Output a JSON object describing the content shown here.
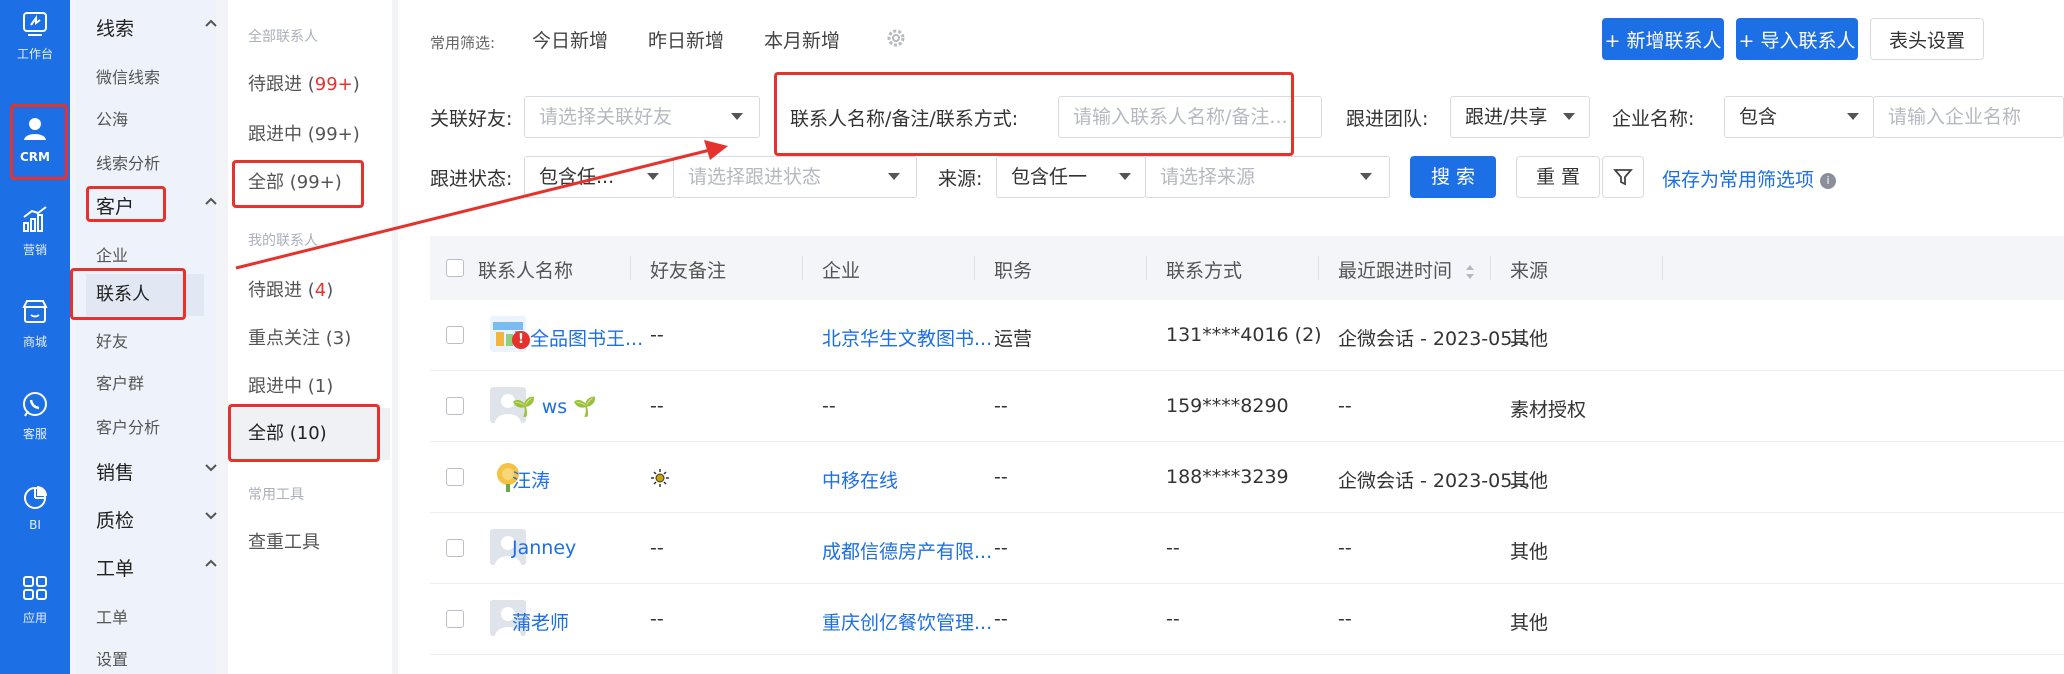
{
  "rail": {
    "items": [
      {
        "label": "工作台",
        "icon": "dashboard-icon"
      },
      {
        "label": "CRM",
        "icon": "user-icon"
      },
      {
        "label": "营销",
        "icon": "chart-icon"
      },
      {
        "label": "商城",
        "icon": "store-icon"
      },
      {
        "label": "客服",
        "icon": "whatsapp-icon"
      },
      {
        "label": "BI",
        "icon": "pie-icon"
      },
      {
        "label": "应用",
        "icon": "apps-icon"
      }
    ]
  },
  "menu": {
    "groups": [
      {
        "label": "线索"
      },
      {
        "label": "客户"
      },
      {
        "label": "销售"
      },
      {
        "label": "质检"
      },
      {
        "label": "工单"
      }
    ],
    "subs": {
      "leads": [
        "微信线索",
        "公海",
        "线索分析"
      ],
      "customer": [
        "企业",
        "联系人",
        "好友",
        "客户群",
        "客户分析"
      ],
      "workorder": [
        "工单",
        "设置"
      ]
    }
  },
  "groups": {
    "all_title": "全部联系人",
    "all_items": [
      {
        "label": "待跟进 (",
        "count": "99+",
        "suffix": ")"
      },
      {
        "label": "跟进中 (99+)"
      },
      {
        "label": "全部 (99+)"
      }
    ],
    "mine_title": "我的联系人",
    "mine_items": [
      {
        "label": "待跟进 (",
        "count": "4",
        "suffix": ")"
      },
      {
        "label": "重点关注 (3)"
      },
      {
        "label": "跟进中 (1)"
      },
      {
        "label": "全部 (10)"
      }
    ],
    "tools_title": "常用工具",
    "tools_items": [
      {
        "label": "查重工具"
      }
    ]
  },
  "toolbar": {
    "quick_title": "常用筛选:",
    "quick": [
      "今日新增",
      "昨日新增",
      "本月新增"
    ],
    "new_contact": "+ 新增联系人",
    "import_contact": "+ 导入联系人",
    "header_settings": "表头设置"
  },
  "filters": {
    "friend_label": "关联好友:",
    "friend_placeholder": "请选择关联好友",
    "name_label": "联系人名称/备注/联系方式:",
    "name_placeholder": "请输入联系人名称/备注...",
    "team_label": "跟进团队:",
    "team_value": "跟进/共享",
    "company_label": "企业名称:",
    "company_op": "包含",
    "company_placeholder": "请输入企业名称",
    "status_label": "跟进状态:",
    "status_op": "包含任...",
    "status_placeholder": "请选择跟进状态",
    "source_label": "来源:",
    "source_op": "包含任一",
    "source_placeholder": "请选择来源",
    "search": "搜 索",
    "reset": "重 置",
    "save_filter": "保存为常用筛选项"
  },
  "table": {
    "headers": [
      "联系人名称",
      "好友备注",
      "企业",
      "职务",
      "联系方式",
      "最近跟进时间",
      "来源"
    ],
    "rows": [
      {
        "name": "全品图书王...",
        "remark": "--",
        "company": "北京华生文教图书...",
        "title": "运营",
        "contact": "131****4016 (2)",
        "last": "企微会话 - 2023-05...",
        "source": "其他",
        "name_link": true,
        "alert": true
      },
      {
        "name": "ws",
        "remark": "--",
        "company": "--",
        "title": "--",
        "contact": "159****8290",
        "last": "--",
        "source": "素材授权",
        "name_link": true
      },
      {
        "name": "汪涛",
        "remark": "",
        "company": "中移在线",
        "title": "--",
        "contact": "188****3239",
        "last": "企微会话 - 2023-05...",
        "source": "其他",
        "name_link": true
      },
      {
        "name": "Janney",
        "remark": "--",
        "company": "成都信德房产有限...",
        "title": "--",
        "contact": "--",
        "last": "--",
        "source": "其他",
        "name_link": true
      },
      {
        "name": "蒲老师",
        "remark": "--",
        "company": "重庆创亿餐饮管理...",
        "title": "--",
        "contact": "--",
        "last": "--",
        "source": "其他",
        "name_link": true
      }
    ]
  },
  "colors": {
    "primary": "#1d6fe5",
    "annotation": "#e5322d"
  }
}
